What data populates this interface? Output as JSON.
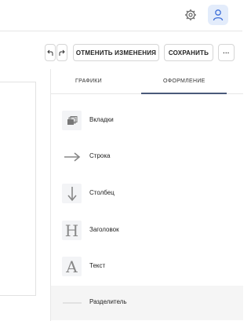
{
  "header": {},
  "toolbar": {
    "revert_label": "ОТМЕНИТЬ ИЗМЕНЕНИЯ",
    "save_label": "СОХРАНИТЬ",
    "more_label": "···"
  },
  "panel": {
    "tabs": [
      {
        "label": "ГРАФИКИ"
      },
      {
        "label": "ОФОРМЛЕНИЕ",
        "active": true
      }
    ],
    "items": [
      {
        "label": "Вкладки",
        "icon": "tabs-icon"
      },
      {
        "label": "Строка",
        "icon": "arrow-right-icon"
      },
      {
        "label": "Столбец",
        "icon": "arrow-down-icon"
      },
      {
        "label": "Заголовок",
        "icon": "heading-icon",
        "glyph": "H"
      },
      {
        "label": "Текст",
        "icon": "text-icon",
        "glyph": "A"
      },
      {
        "label": "Разделитель",
        "icon": "divider-icon"
      }
    ]
  },
  "colors": {
    "accent": "#4a5a7a",
    "avatar_bg": "#e3ecfb",
    "avatar_fg": "#3f6fd8"
  }
}
